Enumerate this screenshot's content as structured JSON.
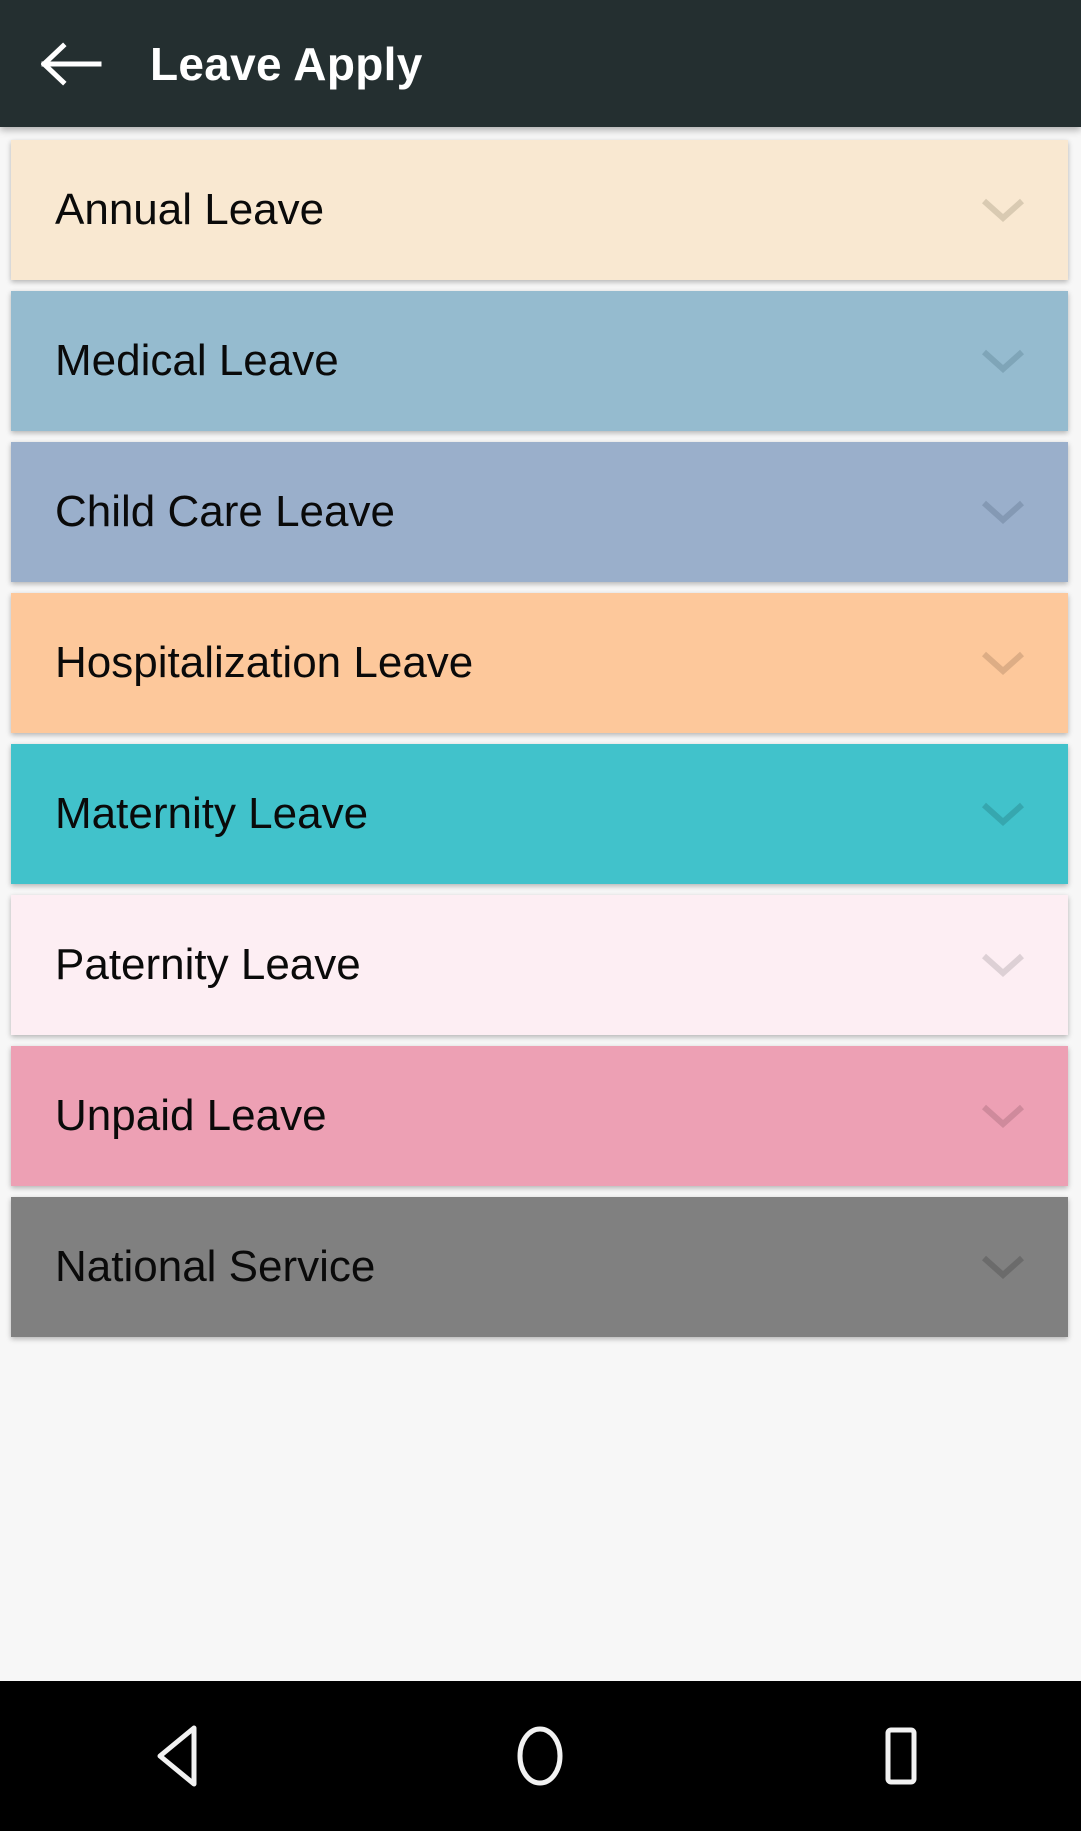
{
  "appbar": {
    "title": "Leave Apply",
    "back_icon": "arrow-left-icon",
    "background_color": "#242f30",
    "title_color": "#ffffff"
  },
  "page": {
    "background_color": "#f7f7f7"
  },
  "leave_types": [
    {
      "label": "Annual Leave",
      "color": "#f9e8d1",
      "expand_icon": "chevron-down-icon",
      "chevron_color": "#d9cab2"
    },
    {
      "label": "Medical Leave",
      "color": "#95bbcf",
      "expand_icon": "chevron-down-icon",
      "chevron_color": "#7fa5b8"
    },
    {
      "label": "Child Care Leave",
      "color": "#9aafcb",
      "expand_icon": "chevron-down-icon",
      "chevron_color": "#8499b4"
    },
    {
      "label": "Hospitalization Leave",
      "color": "#fdc89b",
      "expand_icon": "chevron-down-icon",
      "chevron_color": "#ddad85"
    },
    {
      "label": "Maternity Leave",
      "color": "#41c2cb",
      "expand_icon": "chevron-down-icon",
      "chevron_color": "#36a7af"
    },
    {
      "label": "Paternity Leave",
      "color": "#fdeef3",
      "expand_icon": "chevron-down-icon",
      "chevron_color": "#ddd0d5"
    },
    {
      "label": "Unpaid Leave",
      "color": "#eda0b4",
      "expand_icon": "chevron-down-icon",
      "chevron_color": "#cf8a9c"
    },
    {
      "label": "National Service",
      "color": "#808080",
      "expand_icon": "chevron-down-icon",
      "chevron_color": "#6b6b6b"
    }
  ],
  "navbar": {
    "background_color": "#000000",
    "buttons": [
      {
        "name": "back-triangle-icon"
      },
      {
        "name": "home-circle-icon"
      },
      {
        "name": "recents-square-icon"
      }
    ]
  }
}
